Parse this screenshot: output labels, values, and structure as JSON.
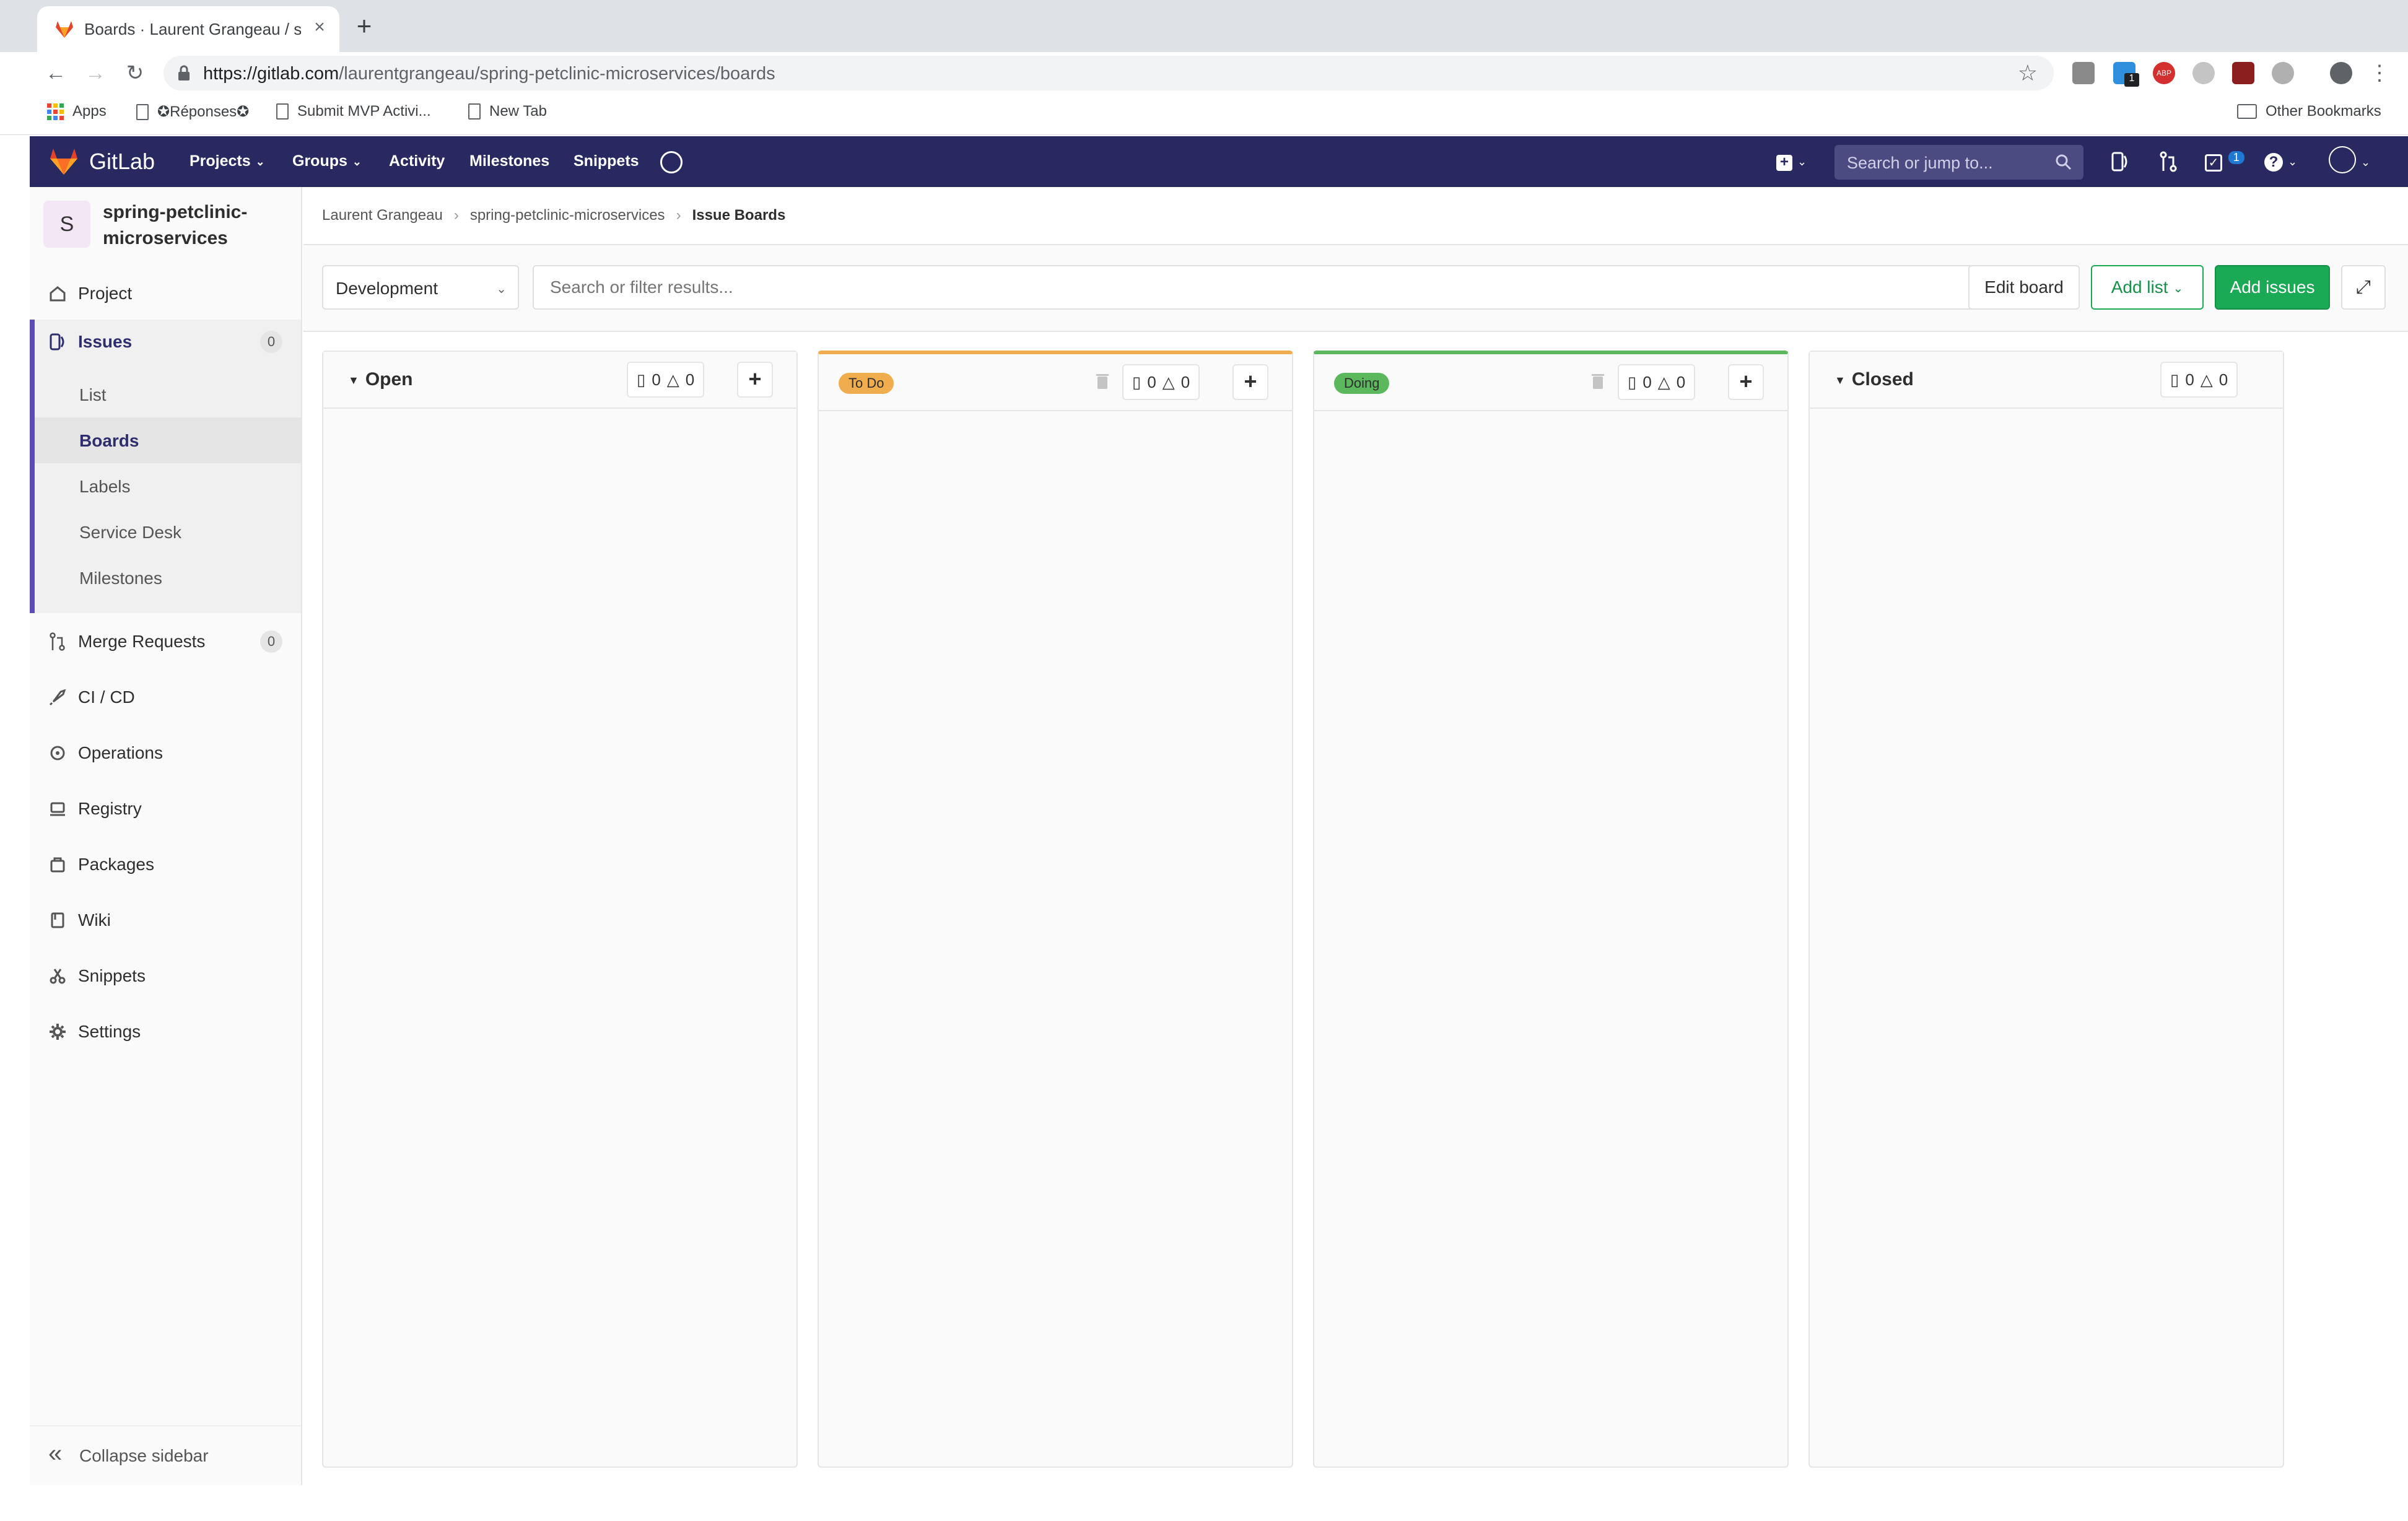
{
  "browser": {
    "tab_title": "Boards · Laurent Grangeau / sp",
    "url_host": "https://gitlab.com",
    "url_path": "/laurentgrangeau/spring-petclinic-microservices/boards",
    "bookmarks": [
      "Apps",
      "✪Réponses✪",
      "Submit MVP Activi...",
      "New Tab"
    ],
    "other_bookmarks": "Other Bookmarks",
    "extension_badge": "1"
  },
  "header": {
    "brand": "GitLab",
    "nav": [
      "Projects",
      "Groups",
      "Activity",
      "Milestones",
      "Snippets"
    ],
    "search_placeholder": "Search or jump to...",
    "todo_count": "1"
  },
  "sidebar": {
    "project_initial": "S",
    "project_name": "spring-petclinic-microservices",
    "items": [
      {
        "label": "Project",
        "icon": "home-icon"
      },
      {
        "label": "Issues",
        "count": "0",
        "icon": "issues-icon"
      },
      {
        "label": "Merge Requests",
        "count": "0",
        "icon": "merge-request-icon"
      },
      {
        "label": "CI / CD",
        "icon": "rocket-icon"
      },
      {
        "label": "Operations",
        "icon": "operations-icon"
      },
      {
        "label": "Registry",
        "icon": "registry-icon"
      },
      {
        "label": "Packages",
        "icon": "package-icon"
      },
      {
        "label": "Wiki",
        "icon": "book-icon"
      },
      {
        "label": "Snippets",
        "icon": "scissors-icon"
      },
      {
        "label": "Settings",
        "icon": "gear-icon"
      }
    ],
    "issues_sub": [
      "List",
      "Boards",
      "Labels",
      "Service Desk",
      "Milestones"
    ],
    "collapse_label": "Collapse sidebar"
  },
  "breadcrumb": [
    "Laurent Grangeau",
    "spring-petclinic-microservices",
    "Issue Boards"
  ],
  "filter": {
    "board_name": "Development",
    "search_placeholder": "Search or filter results...",
    "edit_board": "Edit board",
    "add_list": "Add list",
    "add_issues": "Add issues"
  },
  "lists": [
    {
      "title": "Open",
      "issues": "0",
      "weight": "0"
    },
    {
      "title": "To Do",
      "issues": "0",
      "weight": "0",
      "color": "#f0ad4e"
    },
    {
      "title": "Doing",
      "issues": "0",
      "weight": "0",
      "color": "#5cb85c"
    },
    {
      "title": "Closed",
      "issues": "0",
      "weight": "0"
    }
  ]
}
